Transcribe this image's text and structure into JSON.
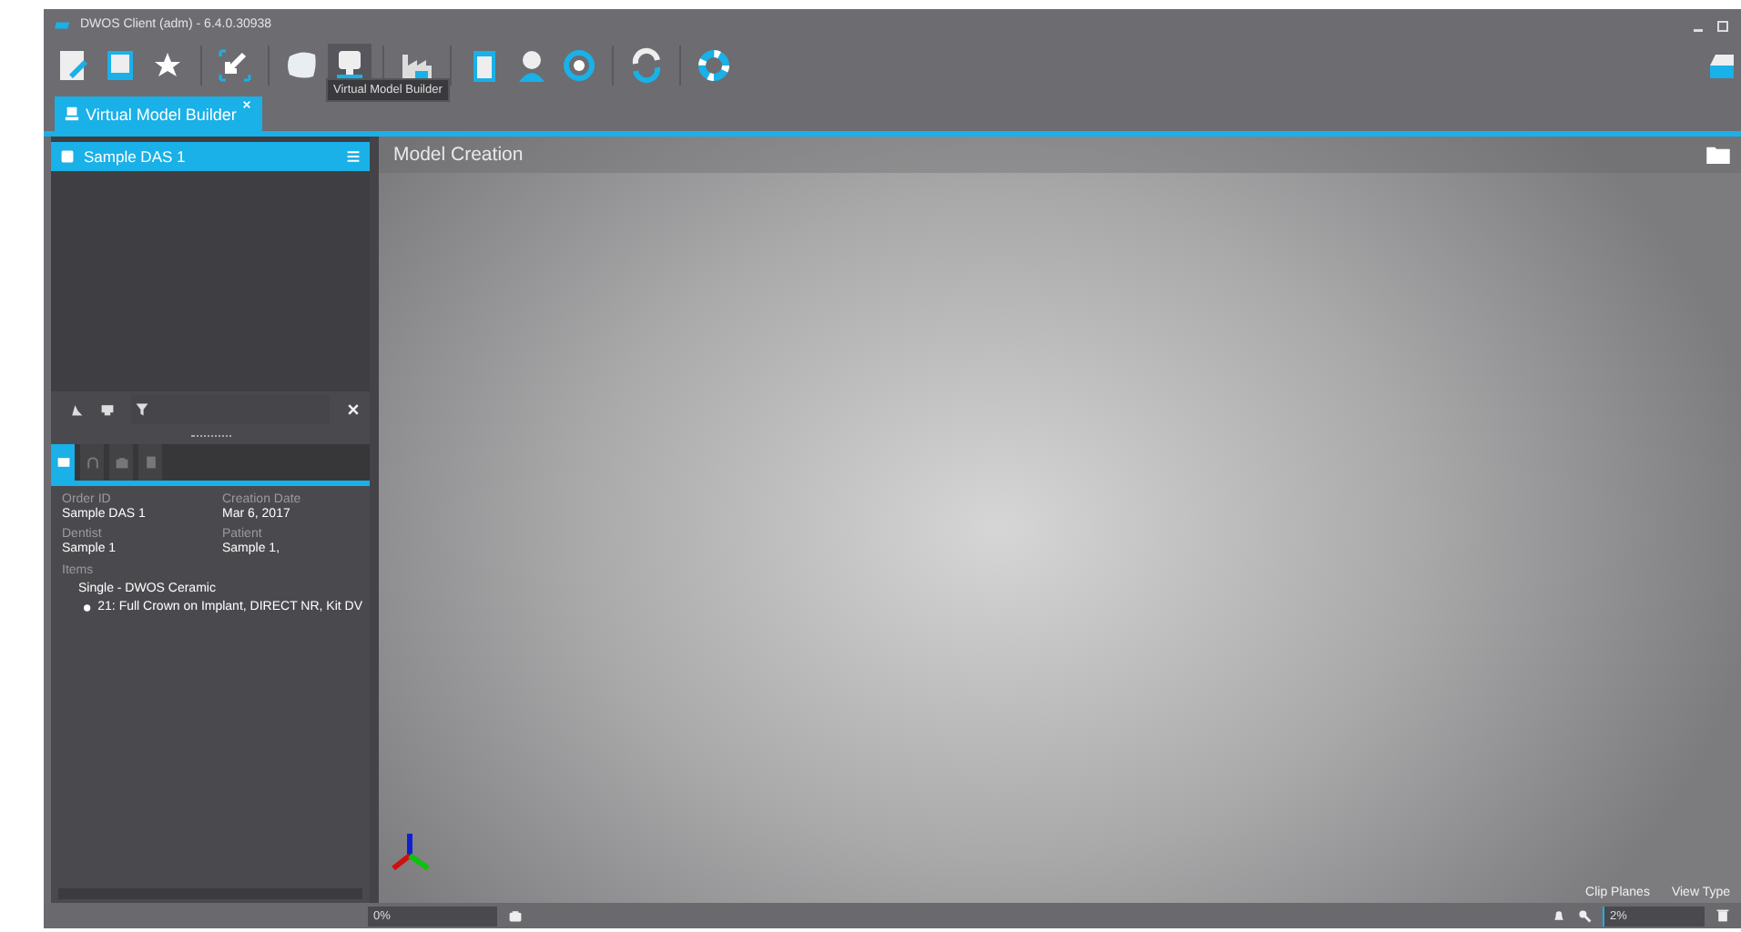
{
  "window": {
    "title": "DWOS Client (adm) - 6.4.0.30938"
  },
  "toolbar": {
    "groups": [
      [
        {
          "kind": "edit",
          "selected": false
        },
        {
          "kind": "list",
          "selected": false
        },
        {
          "kind": "star",
          "selected": false
        }
      ],
      [
        {
          "kind": "import",
          "selected": false
        }
      ],
      [
        {
          "kind": "shape",
          "selected": false
        },
        {
          "kind": "monitor",
          "selected": true
        }
      ],
      [
        {
          "kind": "factory",
          "selected": false
        }
      ],
      [
        {
          "kind": "clipboard",
          "selected": false
        },
        {
          "kind": "user",
          "selected": false
        },
        {
          "kind": "gear",
          "selected": false
        }
      ],
      [
        {
          "kind": "refresh",
          "selected": false
        }
      ],
      [
        {
          "kind": "lifebuoy",
          "selected": false
        }
      ]
    ],
    "tooltip": "Virtual Model Builder"
  },
  "tabs": [
    {
      "label": "Virtual Model Builder",
      "selected": true
    }
  ],
  "order_list": {
    "items": [
      {
        "label": "Sample DAS 1",
        "selected": true
      }
    ]
  },
  "detail_tabs": [
    {
      "kind": "info",
      "selected": true
    },
    {
      "kind": "scan",
      "selected": false
    },
    {
      "kind": "camera",
      "selected": false
    },
    {
      "kind": "notes",
      "selected": false
    }
  ],
  "details": {
    "fields": [
      {
        "label": "Order ID",
        "value": "Sample DAS 1"
      },
      {
        "label": "Creation Date",
        "value": "Mar 6, 2017"
      },
      {
        "label": "Dentist",
        "value": "Sample 1"
      },
      {
        "label": "Patient",
        "value": "Sample 1,"
      }
    ],
    "items_label": "Items",
    "items": [
      {
        "label": "Single - DWOS Ceramic",
        "children": [
          {
            "label": "21: Full Crown on Implant, DIRECT NR, Kit DV"
          }
        ]
      }
    ]
  },
  "viewport": {
    "title": "Model Creation",
    "controls": [
      "Clip Planes",
      "View Type"
    ]
  },
  "status_bar": {
    "left_progress": "0%",
    "right_progress": "2%"
  }
}
